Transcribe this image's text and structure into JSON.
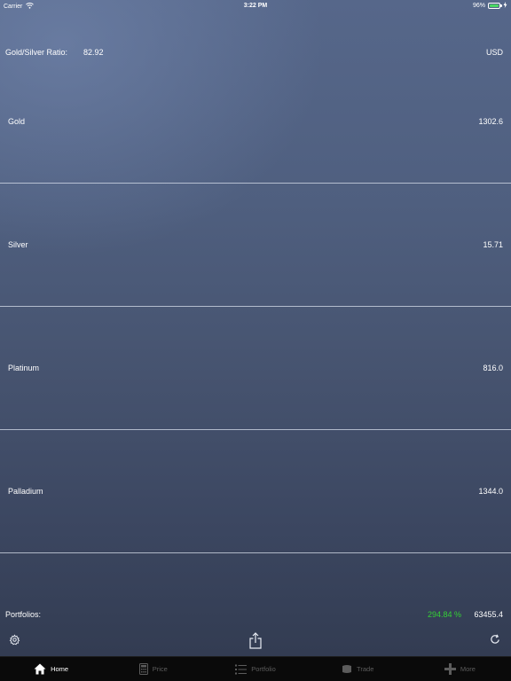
{
  "status_bar": {
    "carrier": "Carrier",
    "time": "3:22 PM",
    "battery_percent": "96%",
    "battery_level": 0.96
  },
  "ratio": {
    "label": "Gold/Silver Ratio:",
    "value": "82.92",
    "currency": "USD"
  },
  "metals": [
    {
      "name": "Gold",
      "price": "1302.6"
    },
    {
      "name": "Silver",
      "price": "15.71"
    },
    {
      "name": "Platinum",
      "price": "816.0"
    },
    {
      "name": "Palladium",
      "price": "1344.0"
    }
  ],
  "portfolios": {
    "label": "Portfolios:",
    "change": "294.84 %",
    "value": "63455.4",
    "change_color": "#35d135"
  },
  "toolbar": {
    "settings_icon": "gear-icon",
    "share_icon": "share-icon",
    "refresh_icon": "refresh-icon"
  },
  "tabs": [
    {
      "label": "Home",
      "icon": "home-icon",
      "active": true
    },
    {
      "label": "Price",
      "icon": "calculator-icon",
      "active": false
    },
    {
      "label": "Portfolio",
      "icon": "list-icon",
      "active": false
    },
    {
      "label": "Trade",
      "icon": "trade-icon",
      "active": false
    },
    {
      "label": "More",
      "icon": "plus-icon",
      "active": false
    }
  ]
}
